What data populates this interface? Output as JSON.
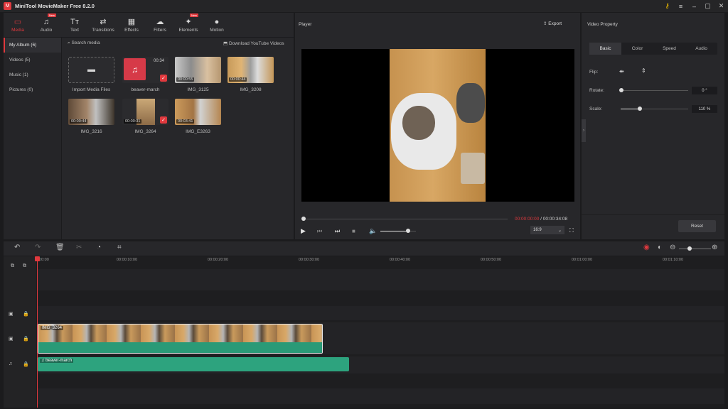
{
  "app": {
    "title": "MiniTool MovieMaker Free 8.2.0",
    "logo_letter": "M",
    "accent": "#e0393e"
  },
  "window_controls": {
    "key": "⚷",
    "menu": "≡",
    "minimize": "–",
    "maximize": "▢",
    "close": "✕"
  },
  "toolbar": {
    "items": [
      {
        "label": "Media",
        "icon": "▭",
        "new": false
      },
      {
        "label": "Audio",
        "icon": "♫",
        "new": true
      },
      {
        "label": "Text",
        "icon": "Tт",
        "new": false
      },
      {
        "label": "Transitions",
        "icon": "⇄",
        "new": false
      },
      {
        "label": "Effects",
        "icon": "▦",
        "new": false
      },
      {
        "label": "Filters",
        "icon": "☁",
        "new": false
      },
      {
        "label": "Elements",
        "icon": "✦",
        "new": true
      },
      {
        "label": "Motion",
        "icon": "●",
        "new": false
      }
    ],
    "new_badge": "New"
  },
  "sidebar": {
    "items": [
      {
        "label": "My Album (6)"
      },
      {
        "label": "Videos (5)"
      },
      {
        "label": "Music (1)"
      },
      {
        "label": "Pictures (0)"
      }
    ]
  },
  "media": {
    "search_placeholder": "Search media",
    "download_label": "Download YouTube Videos",
    "import_label": "Import Media Files",
    "items": [
      {
        "name": "beaver-march",
        "duration": "00:34",
        "type": "music"
      },
      {
        "name": "IMG_3125",
        "duration": "00:00:55",
        "type": "video"
      },
      {
        "name": "IMG_3208",
        "duration": "00:00:44",
        "type": "video"
      },
      {
        "name": "IMG_3216",
        "duration": "00:00:44",
        "type": "video"
      },
      {
        "name": "IMG_3264",
        "duration": "00:00:31",
        "type": "video"
      },
      {
        "name": "IMG_E3263",
        "duration": "00:03:41",
        "type": "video"
      }
    ]
  },
  "player": {
    "title": "Player",
    "export_label": "Export",
    "current_time": "00:00:00:00",
    "separator": " / ",
    "total_time": "00:00:34:08",
    "aspect": "16:9",
    "volume": 0.78,
    "progress": 0.0
  },
  "property": {
    "title": "Video Property",
    "tabs": [
      "Basic",
      "Color",
      "Speed",
      "Audio"
    ],
    "flip_label": "Flip:",
    "rotate_label": "Rotate:",
    "rotate_value": "0 °",
    "scale_label": "Scale:",
    "scale_value": "110 %",
    "reset_label": "Reset"
  },
  "timeline": {
    "ruler": [
      "00:00",
      "00:00:10:00",
      "00:00:20:00",
      "00:00:30:00",
      "00:00:40:00",
      "00:00:50:00",
      "00:01:00:00",
      "00:01:10:00"
    ],
    "video_clip": "IMG_3264",
    "audio_clip": "beaver-march"
  }
}
